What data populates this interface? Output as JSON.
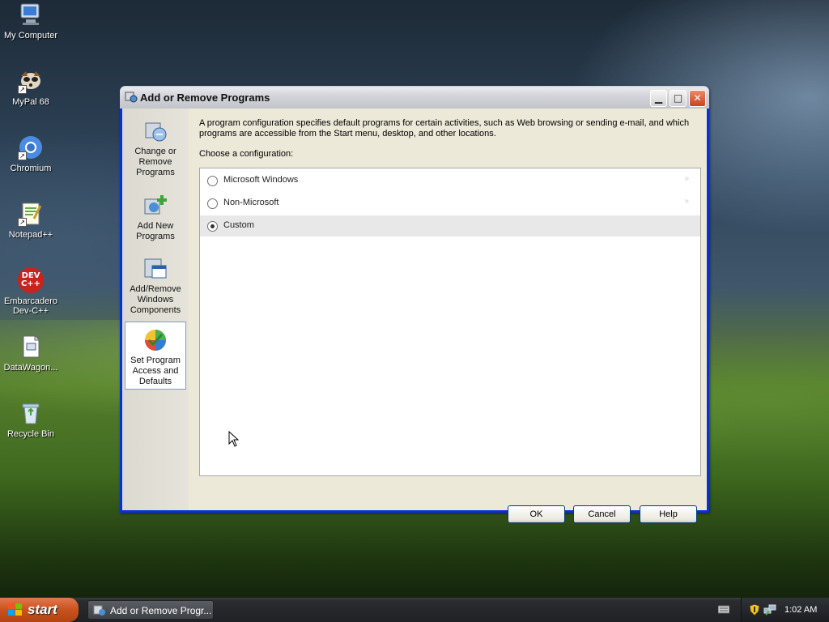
{
  "desktop": {
    "icons": [
      {
        "label": "My Computer",
        "icon": "computer-icon"
      },
      {
        "label": "MyPal 68",
        "icon": "mypal-icon"
      },
      {
        "label": "Chromium",
        "icon": "chromium-icon"
      },
      {
        "label": "Notepad++",
        "icon": "notepadpp-icon"
      },
      {
        "label": "Embarcadero\nDev-C++",
        "icon": "devcpp-icon",
        "badge": "DEV\nC++"
      },
      {
        "label": "DataWagon...",
        "icon": "document-icon"
      },
      {
        "label": "Recycle Bin",
        "icon": "recycle-bin-icon"
      }
    ]
  },
  "window": {
    "title": "Add or Remove Programs",
    "sidebar": [
      {
        "label": "Change or\nRemove\nPrograms",
        "icon": "change-remove-icon"
      },
      {
        "label": "Add New\nPrograms",
        "icon": "add-new-programs-icon"
      },
      {
        "label": "Add/Remove\nWindows\nComponents",
        "icon": "windows-components-icon"
      },
      {
        "label": "Set Program\nAccess and\nDefaults",
        "icon": "program-access-icon",
        "active": true
      }
    ],
    "description": "A program configuration specifies default programs for certain activities, such as Web browsing or sending e-mail, and which programs are accessible from the Start menu, desktop, and other locations.",
    "choose_label": "Choose a configuration:",
    "options": [
      {
        "label": "Microsoft Windows",
        "selected": false
      },
      {
        "label": "Non-Microsoft",
        "selected": false
      },
      {
        "label": "Custom",
        "selected": true
      }
    ],
    "buttons": {
      "ok": "OK",
      "cancel": "Cancel",
      "help": "Help"
    }
  },
  "taskbar": {
    "start_label": "start",
    "task_item": "Add or Remove Progr...",
    "clock": "1:02 AM"
  }
}
